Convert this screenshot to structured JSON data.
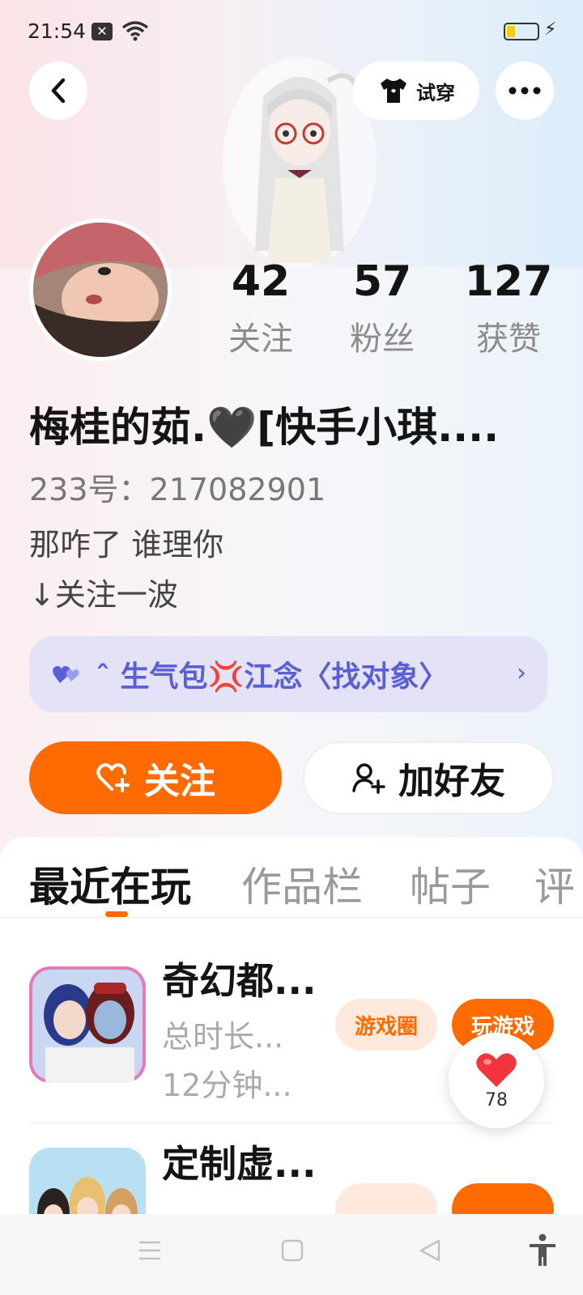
{
  "status_bar": {
    "time": "21:54"
  },
  "header": {
    "tryon_label": "试穿"
  },
  "stats": [
    {
      "value": "42",
      "label": "关注"
    },
    {
      "value": "57",
      "label": "粉丝"
    },
    {
      "value": "127",
      "label": "获赞"
    }
  ],
  "profile": {
    "nickname": "梅桂的茹.🖤[快手小琪....",
    "uid": "233号：217082901",
    "bio_line1": "那咋了 谁理你",
    "bio_line2": "↓关注一波"
  },
  "club": {
    "label": "ˆ 生气包💢江念〈找对象〉"
  },
  "actions": {
    "follow_label": "关注",
    "add_friend_label": "加好友"
  },
  "tabs": [
    {
      "label": "最近在玩"
    },
    {
      "label": "作品栏"
    },
    {
      "label": "帖子"
    },
    {
      "label": "评"
    }
  ],
  "games": [
    {
      "name": "奇幻都...",
      "meta1": "总时长...",
      "meta2": "12分钟...",
      "circle_label": "游戏圈",
      "play_label": "玩游戏"
    },
    {
      "name": "定制虚..."
    }
  ],
  "like_float": {
    "count": "78"
  },
  "colors": {
    "accent": "#ff6b00",
    "club": "#5b5fd6"
  }
}
